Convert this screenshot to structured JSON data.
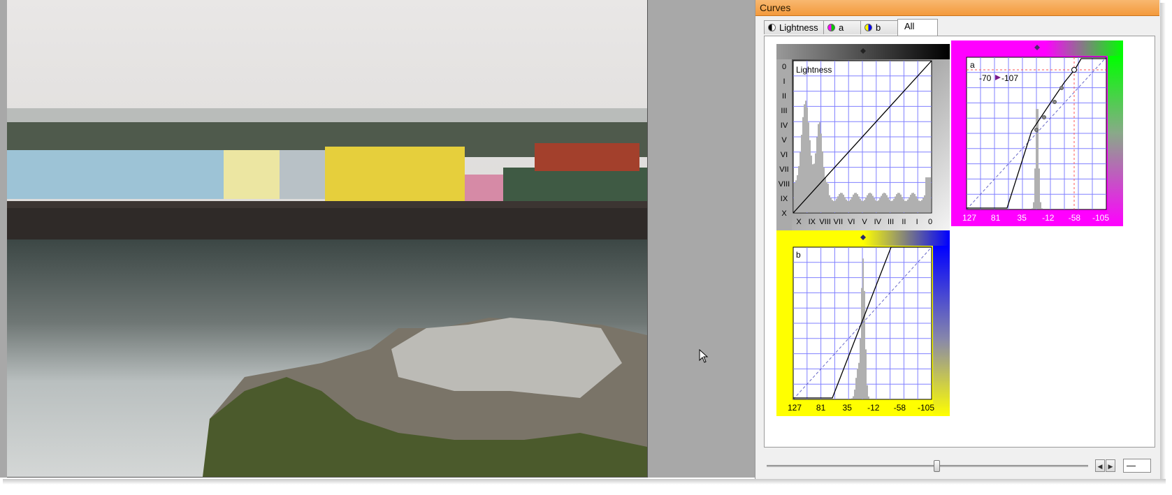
{
  "panel": {
    "title": "Curves"
  },
  "tabs": [
    {
      "label": "Lightness",
      "icon": "lightness-channel-icon"
    },
    {
      "label": "a",
      "icon": "a-channel-icon"
    },
    {
      "label": "b",
      "icon": "b-channel-icon"
    },
    {
      "label": "All",
      "active": true
    }
  ],
  "curves": {
    "lightness": {
      "label": "Lightness",
      "y_ticks": [
        "0",
        "I",
        "II",
        "III",
        "IV",
        "V",
        "VI",
        "VII",
        "VIII",
        "IX",
        "X"
      ],
      "x_ticks": [
        "X",
        "IX",
        "VIII",
        "VII",
        "VI",
        "V",
        "IV",
        "III",
        "II",
        "I",
        "0"
      ],
      "border_colors": [
        "#000000",
        "#ffffff"
      ]
    },
    "a": {
      "label": "a",
      "readout_in": "-70",
      "readout_out": "-107",
      "x_ticks": [
        "127",
        "81",
        "35",
        "-12",
        "-58",
        "-105"
      ],
      "border_colors": [
        "#ff00ff",
        "#00ff00"
      ]
    },
    "b": {
      "label": "b",
      "x_ticks": [
        "127",
        "81",
        "35",
        "-12",
        "-58",
        "-105"
      ],
      "border_colors": [
        "#ffff00",
        "#0000ff"
      ]
    }
  },
  "bottom": {
    "value": "—"
  },
  "colors": {
    "title_bar": "#f39a3c",
    "grid": "#8080ff"
  }
}
